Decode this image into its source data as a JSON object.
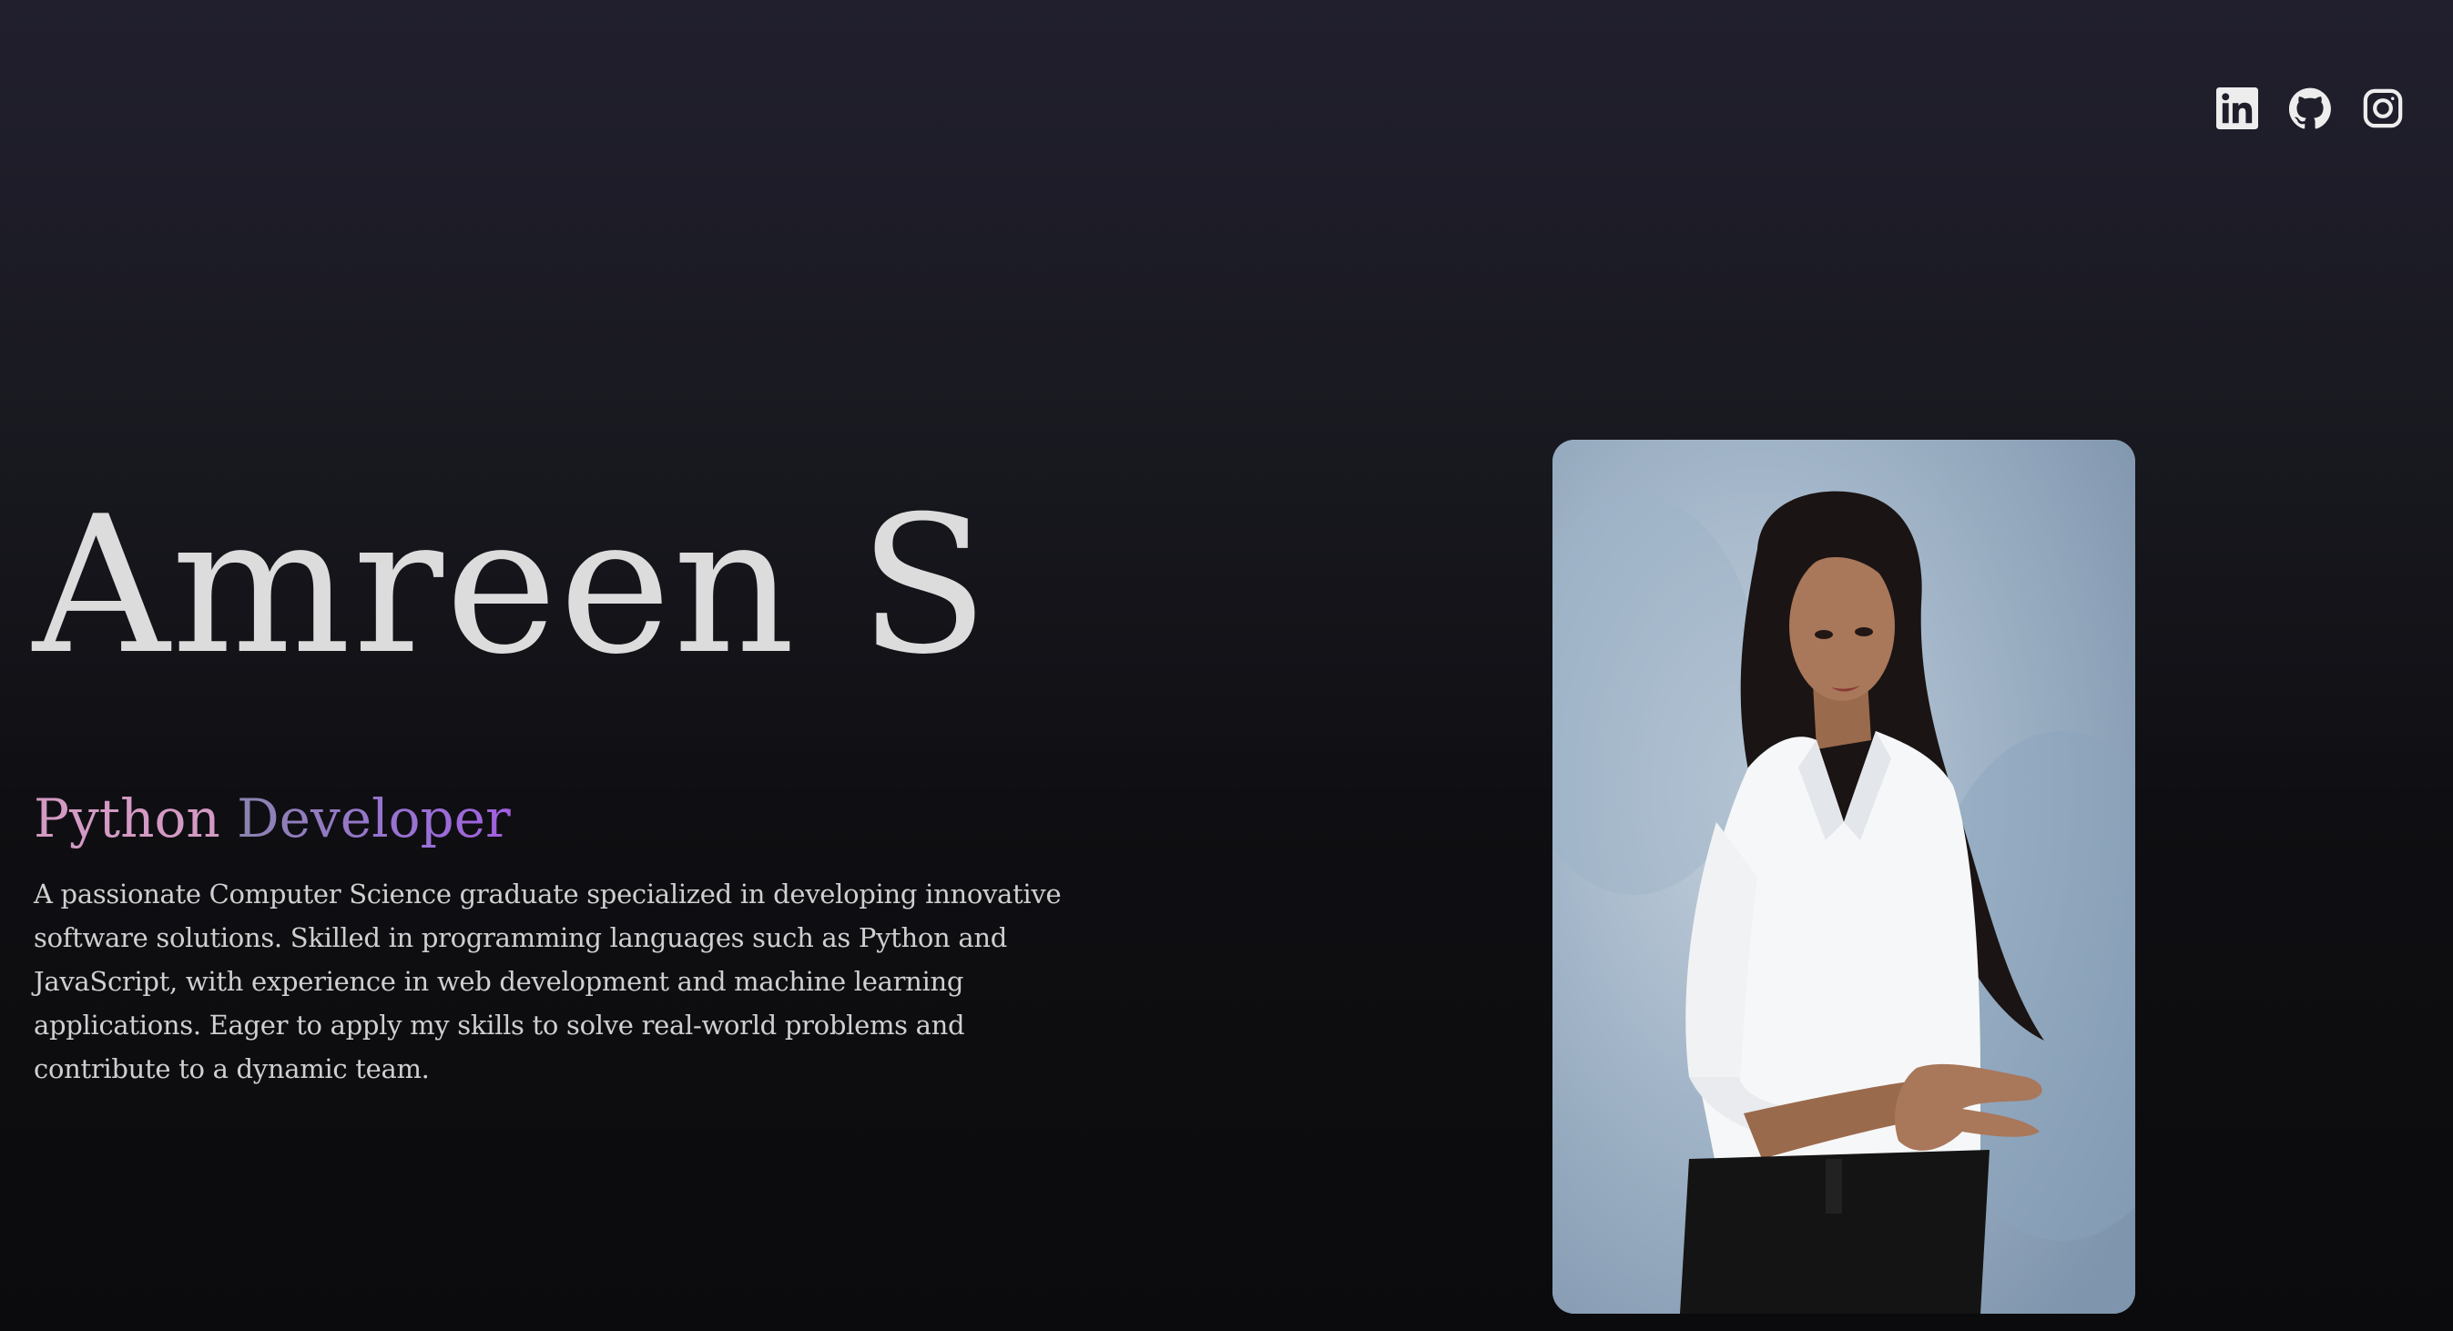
{
  "social": {
    "items": [
      {
        "name": "linkedin-icon"
      },
      {
        "name": "github-icon"
      },
      {
        "name": "instagram-icon"
      }
    ]
  },
  "hero": {
    "name": "Amreen S",
    "role_word1": "Python",
    "role_word2": "Developer",
    "bio": "A passionate Computer Science graduate specialized in developing innovative software solutions. Skilled in programming languages such as Python and JavaScript, with experience in web development and machine learning applications. Eager to apply my skills to solve real-world problems and contribute to a dynamic team."
  },
  "colors": {
    "role_word1": "#d39ac3",
    "role_word2_gradient_start": "#8c84b0",
    "role_word2_gradient_end": "#a35ee0",
    "name_text": "#dcdcdc",
    "background_top": "#211f2e",
    "background_bottom": "#0b0b0d"
  }
}
